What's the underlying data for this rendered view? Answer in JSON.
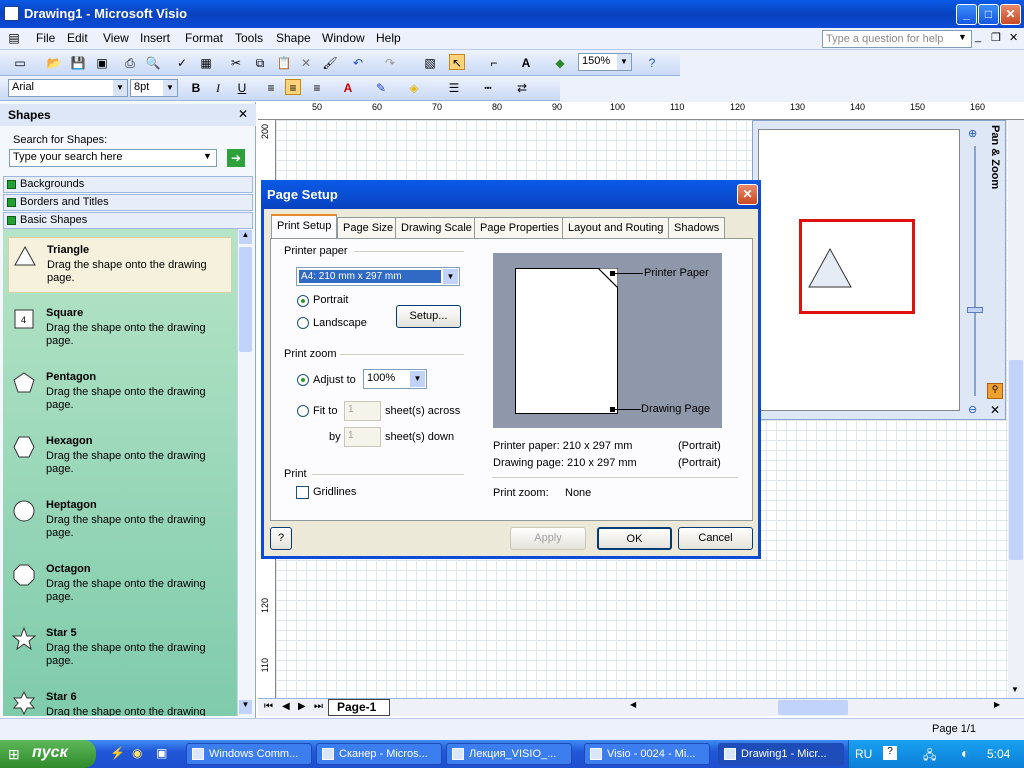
{
  "window": {
    "title": "Drawing1 - Microsoft Visio",
    "min": "_",
    "max": "□",
    "close": "✕"
  },
  "menu": {
    "items": [
      "File",
      "Edit",
      "View",
      "Insert",
      "Format",
      "Tools",
      "Shape",
      "Window",
      "Help"
    ],
    "help_placeholder": "Type a question for help"
  },
  "toolbar": {
    "zoom": "150%",
    "font": "Arial",
    "size": "8pt",
    "bold": "B",
    "italic": "I",
    "underline": "U"
  },
  "shapes_panel": {
    "title": "Shapes",
    "search_label": "Search for Shapes:",
    "search_placeholder": "Type your search here",
    "categories": [
      "Backgrounds",
      "Borders and Titles",
      "Basic Shapes"
    ],
    "items": [
      {
        "name": "Triangle",
        "desc": "Drag the shape onto the drawing page."
      },
      {
        "name": "Square",
        "desc": "Drag the shape onto the drawing page."
      },
      {
        "name": "Pentagon",
        "desc": "Drag the shape onto the drawing page."
      },
      {
        "name": "Hexagon",
        "desc": "Drag the shape onto the drawing page."
      },
      {
        "name": "Heptagon",
        "desc": "Drag the shape onto the drawing page."
      },
      {
        "name": "Octagon",
        "desc": "Drag the shape onto the drawing page."
      },
      {
        "name": "Star 5",
        "desc": "Drag the shape onto the drawing page."
      },
      {
        "name": "Star 6",
        "desc": "Drag the shape onto the drawing"
      }
    ]
  },
  "ruler": {
    "h": [
      "50",
      "60",
      "70",
      "80",
      "90",
      "100",
      "110",
      "120",
      "130",
      "140",
      "150",
      "160"
    ],
    "v": [
      "200",
      "120",
      "110"
    ]
  },
  "pan_zoom": {
    "title": "Pan & Zoom"
  },
  "page_tab": "Page-1",
  "status": {
    "page": "Page 1/1"
  },
  "dialog": {
    "title": "Page Setup",
    "tabs": [
      "Print Setup",
      "Page Size",
      "Drawing Scale",
      "Page Properties",
      "Layout and Routing",
      "Shadows"
    ],
    "printer_paper_label": "Printer paper",
    "paper_value": "A4:  210 mm x 297 mm",
    "portrait": "Portrait",
    "landscape": "Landscape",
    "setup_btn": "Setup...",
    "print_zoom_label": "Print zoom",
    "adjust_to": "Adjust to",
    "adjust_value": "100%",
    "fit_to": "Fit to",
    "fit_across_val": "1",
    "fit_across_label": "sheet(s) across",
    "by": "by",
    "fit_down_val": "1",
    "fit_down_label": "sheet(s) down",
    "print_label": "Print",
    "gridlines": "Gridlines",
    "preview_printer": "Printer Paper",
    "preview_drawing": "Drawing Page",
    "info": {
      "printer_paper": "Printer paper:  210 x 297 mm",
      "printer_orient": "(Portrait)",
      "drawing_page": "Drawing page: 210 x 297 mm",
      "drawing_orient": "(Portrait)",
      "print_zoom": "Print zoom:",
      "print_zoom_val": "None"
    },
    "help": "?",
    "apply": "Apply",
    "ok": "OK",
    "cancel": "Cancel"
  },
  "taskbar": {
    "start": "пуск",
    "tasks": [
      "Windows Comm...",
      "Сканер - Micros...",
      "Лекция_VISIO_...",
      "Visio - 0024 - Mi...",
      "Drawing1 - Micr..."
    ],
    "lang": "RU",
    "time": "5:04"
  }
}
